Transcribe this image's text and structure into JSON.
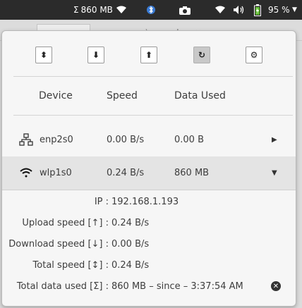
{
  "topbar": {
    "net_total": "860 MB",
    "net_sigma": "Σ",
    "battery_percent": "95 %",
    "icons": [
      "network-monitor-icon",
      "wifi-icon",
      "bluetooth-icon",
      "camera-icon",
      "wifi-icon",
      "volume-icon",
      "battery-charging-icon",
      "chevron-down-icon"
    ]
  },
  "toolbar": {
    "buttons": [
      {
        "name": "sort-updown-button",
        "symbol": "⬍"
      },
      {
        "name": "download-button",
        "symbol": "⬇"
      },
      {
        "name": "upload-button",
        "symbol": "⬆"
      },
      {
        "name": "refresh-button",
        "symbol": "↻"
      },
      {
        "name": "settings-button",
        "symbol": "⚙"
      }
    ]
  },
  "columns": {
    "device": "Device",
    "speed": "Speed",
    "data_used": "Data Used"
  },
  "devices": [
    {
      "name": "enp2s0",
      "speed": "0.00 B/s",
      "data_used": "0.00 B",
      "icon": "ethernet-icon",
      "expanded": false
    },
    {
      "name": "wlp1s0",
      "speed": "0.24 B/s",
      "data_used": "860 MB",
      "icon": "wifi-icon",
      "expanded": true
    }
  ],
  "details": {
    "ip_label": "IP :",
    "ip_value": "192.168.1.193",
    "upload_label": "Upload speed [↑] :",
    "upload_value": "0.24 B/s",
    "download_label": "Download speed [↓] :",
    "download_value": "0.00 B/s",
    "total_speed_label": "Total speed [↕] :",
    "total_speed_value": "0.24 B/s",
    "total_data_label": "Total data used [Σ] :",
    "total_data_value": "860 MB  –  since – 3:37:54 AM"
  }
}
